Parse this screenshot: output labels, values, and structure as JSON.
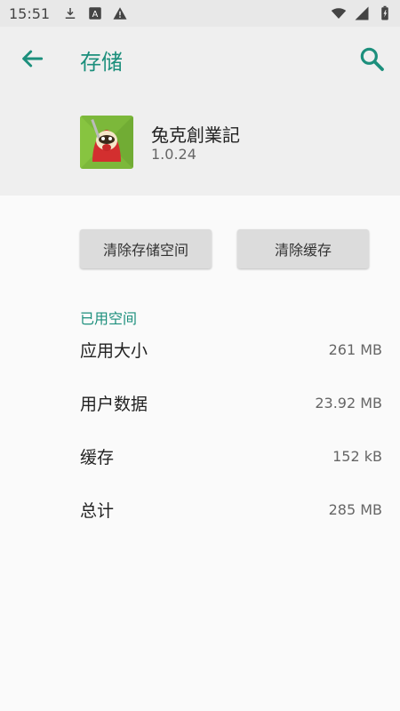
{
  "status_bar": {
    "time": "15:51"
  },
  "app_bar": {
    "title": "存储"
  },
  "app": {
    "name": "兔克創業記",
    "version": "1.0.24"
  },
  "buttons": {
    "clear_storage": "清除存储空间",
    "clear_cache": "清除缓存"
  },
  "storage": {
    "section_label": "已用空间",
    "rows": [
      {
        "label": "应用大小",
        "value": "261 MB"
      },
      {
        "label": "用户数据",
        "value": "23.92 MB"
      },
      {
        "label": "缓存",
        "value": "152 kB"
      },
      {
        "label": "总计",
        "value": "285 MB"
      }
    ]
  },
  "colors": {
    "accent": "#1c8f7c"
  }
}
